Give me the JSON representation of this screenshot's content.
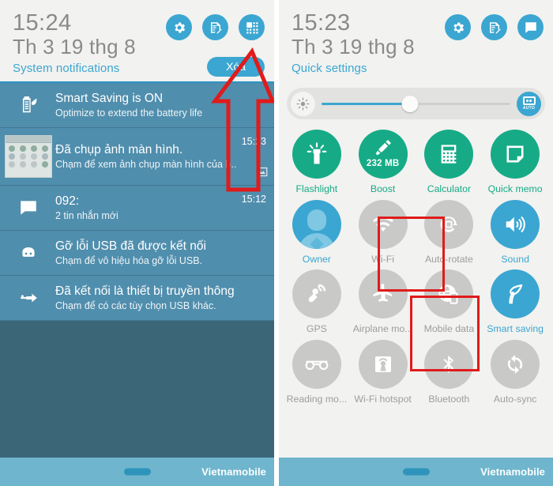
{
  "left_panel": {
    "header": {
      "time": "15:24",
      "date": "Th 3 19 thg 8",
      "subtitle": "System notifications",
      "clear_label": "Xóa",
      "icons": [
        {
          "name": "settings-icon",
          "label": "Settings"
        },
        {
          "name": "edit-note-icon",
          "label": "Quick note"
        },
        {
          "name": "quick-settings-grid-icon",
          "label": "Quick settings"
        }
      ]
    },
    "notifications": [
      {
        "icon": "battery-leaf-icon",
        "title": "Smart Saving is ON",
        "subtitle": "Optimize to extend the battery life",
        "time": "",
        "has_thumb": false,
        "has_image_badge": false
      },
      {
        "icon": "screenshot-thumbnail",
        "title": "Đã chụp ảnh màn hình.",
        "subtitle": "Chạm để xem ảnh chụp màn hình của b..",
        "time": "15:23",
        "has_thumb": true,
        "has_image_badge": true
      },
      {
        "icon": "message-icon",
        "title": "092:",
        "subtitle": "2 tin nhắn mới",
        "time": "15:12",
        "has_thumb": false,
        "has_image_badge": false
      },
      {
        "icon": "android-icon",
        "title": "Gỡ lỗi USB đã được kết nối",
        "subtitle": "Chạm để vô hiệu hóa gỡ lỗi USB.",
        "time": "",
        "has_thumb": false,
        "has_image_badge": false
      },
      {
        "icon": "usb-icon",
        "title": "Đã kết nối là thiết bị truyền thông",
        "subtitle": "Chạm để có các tùy chọn USB khác.",
        "time": "",
        "has_thumb": false,
        "has_image_badge": false
      }
    ],
    "nav": {
      "carrier": "Vietnamobile"
    }
  },
  "right_panel": {
    "header": {
      "time": "15:23",
      "date": "Th 3 19 thg 8",
      "subtitle": "Quick settings",
      "icons": [
        {
          "name": "settings-icon",
          "label": "Settings"
        },
        {
          "name": "edit-note-icon",
          "label": "Quick note"
        },
        {
          "name": "notifications-list-icon",
          "label": "Notifications"
        }
      ]
    },
    "brightness": {
      "icon": "brightness-sun-icon",
      "value_percent": 47,
      "auto_label": "AUTO"
    },
    "tiles": [
      {
        "label": "Flashlight",
        "icon": "flashlight-icon",
        "state": "on",
        "color": "green",
        "sub": ""
      },
      {
        "label": "Boost",
        "icon": "boost-broom-icon",
        "state": "on",
        "color": "green",
        "sub": "232 MB"
      },
      {
        "label": "Calculator",
        "icon": "calculator-icon",
        "state": "on",
        "color": "green",
        "sub": ""
      },
      {
        "label": "Quick memo",
        "icon": "quick-memo-icon",
        "state": "on",
        "color": "green",
        "sub": ""
      },
      {
        "label": "Owner",
        "icon": "owner-avatar-icon",
        "state": "on",
        "color": "avatar",
        "sub": ""
      },
      {
        "label": "Wi-Fi",
        "icon": "wifi-icon",
        "state": "off",
        "color": "grey",
        "sub": ""
      },
      {
        "label": "Auto-rotate",
        "icon": "auto-rotate-icon",
        "state": "off",
        "color": "grey",
        "sub": ""
      },
      {
        "label": "Sound",
        "icon": "sound-icon",
        "state": "on",
        "color": "blue",
        "sub": ""
      },
      {
        "label": "GPS",
        "icon": "gps-icon",
        "state": "off",
        "color": "grey",
        "sub": ""
      },
      {
        "label": "Airplane mo...",
        "icon": "airplane-icon",
        "state": "off",
        "color": "grey",
        "sub": ""
      },
      {
        "label": "Mobile data",
        "icon": "mobile-data-icon",
        "state": "off",
        "color": "grey",
        "sub": ""
      },
      {
        "label": "Smart saving",
        "icon": "leaf-icon",
        "state": "on",
        "color": "blue",
        "sub": ""
      },
      {
        "label": "Reading mo...",
        "icon": "reading-mode-icon",
        "state": "off",
        "color": "grey",
        "sub": ""
      },
      {
        "label": "Wi-Fi hotspot",
        "icon": "hotspot-icon",
        "state": "off",
        "color": "grey",
        "sub": ""
      },
      {
        "label": "Bluetooth",
        "icon": "bluetooth-icon",
        "state": "off",
        "color": "grey",
        "sub": ""
      },
      {
        "label": "Auto-sync",
        "icon": "auto-sync-icon",
        "state": "off",
        "color": "grey",
        "sub": ""
      }
    ],
    "nav": {
      "carrier": "Vietnamobile"
    }
  },
  "annotations": {
    "arrow": {
      "name": "red-up-arrow",
      "points_to": "quick-settings-grid-icon",
      "color": "#e01b1b"
    },
    "boxes": [
      {
        "name": "highlight-box-wifi",
        "target": "Wi-Fi"
      },
      {
        "name": "highlight-box-mobile-data",
        "target": "Mobile data"
      }
    ]
  },
  "colors": {
    "accent_blue": "#3ba6d1",
    "tile_green": "#16ab86",
    "tile_grey": "#c9c9c7",
    "notif_bg": "#508ead",
    "panel_bg": "#f2f2f0",
    "nav_bg": "#6eb5cd",
    "annotation_red": "#e01b1b"
  }
}
